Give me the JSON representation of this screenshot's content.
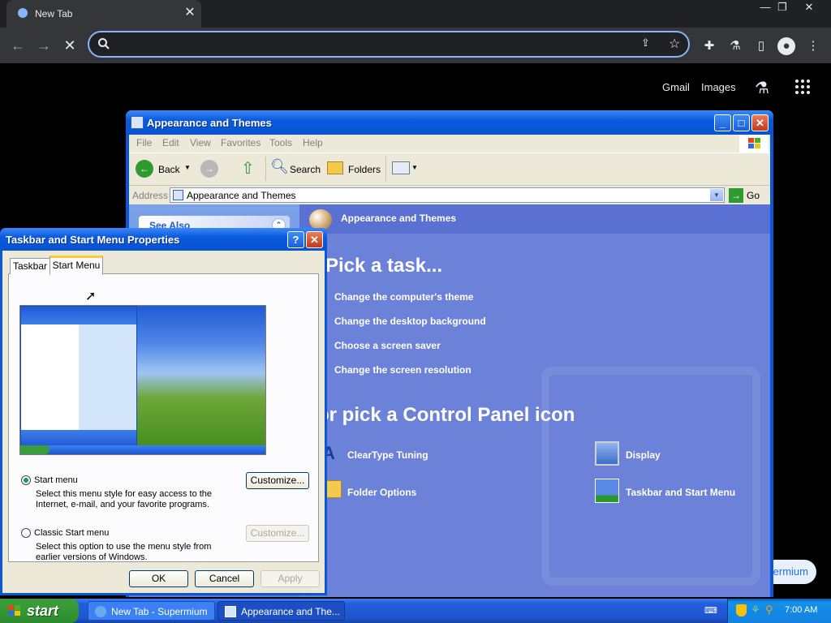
{
  "browser": {
    "tab_title": "New Tab",
    "omnibox_value": "",
    "ntp_links": [
      "Gmail",
      "Images"
    ],
    "supermium_button": "ermium"
  },
  "appearance_window": {
    "title": "Appearance and Themes",
    "menu": [
      "File",
      "Edit",
      "View",
      "Favorites",
      "Tools",
      "Help"
    ],
    "toolbar": {
      "back": "Back",
      "search": "Search",
      "folders": "Folders"
    },
    "address_label": "Address",
    "address_value": "Appearance and Themes",
    "go_label": "Go",
    "see_also": "See Also",
    "header_title": "Appearance and Themes",
    "pick_task": "Pick a task...",
    "tasks": [
      "Change the computer's theme",
      "Change the desktop background",
      "Choose a screen saver",
      "Change the screen resolution"
    ],
    "pick_icon": "or pick a Control Panel icon",
    "icons": [
      "ClearType Tuning",
      "Display",
      "Folder Options",
      "Taskbar and Start Menu"
    ]
  },
  "dialog": {
    "title": "Taskbar and Start Menu Properties",
    "tabs": [
      "Taskbar",
      "Start Menu"
    ],
    "active_tab": "Start Menu",
    "options": [
      {
        "label": "Start menu",
        "selected": true,
        "description": "Select this menu style for easy access to the Internet, e-mail, and your favorite programs.",
        "button": "Customize...",
        "button_enabled": true
      },
      {
        "label": "Classic Start menu",
        "selected": false,
        "description": "Select this option to use the menu style from earlier versions of Windows.",
        "button": "Customize...",
        "button_enabled": false
      }
    ],
    "ok": "OK",
    "cancel": "Cancel",
    "apply": "Apply"
  },
  "taskbar": {
    "start": "start",
    "items": [
      "New Tab - Supermium",
      "Appearance and The..."
    ],
    "clock": "7:00 AM"
  }
}
